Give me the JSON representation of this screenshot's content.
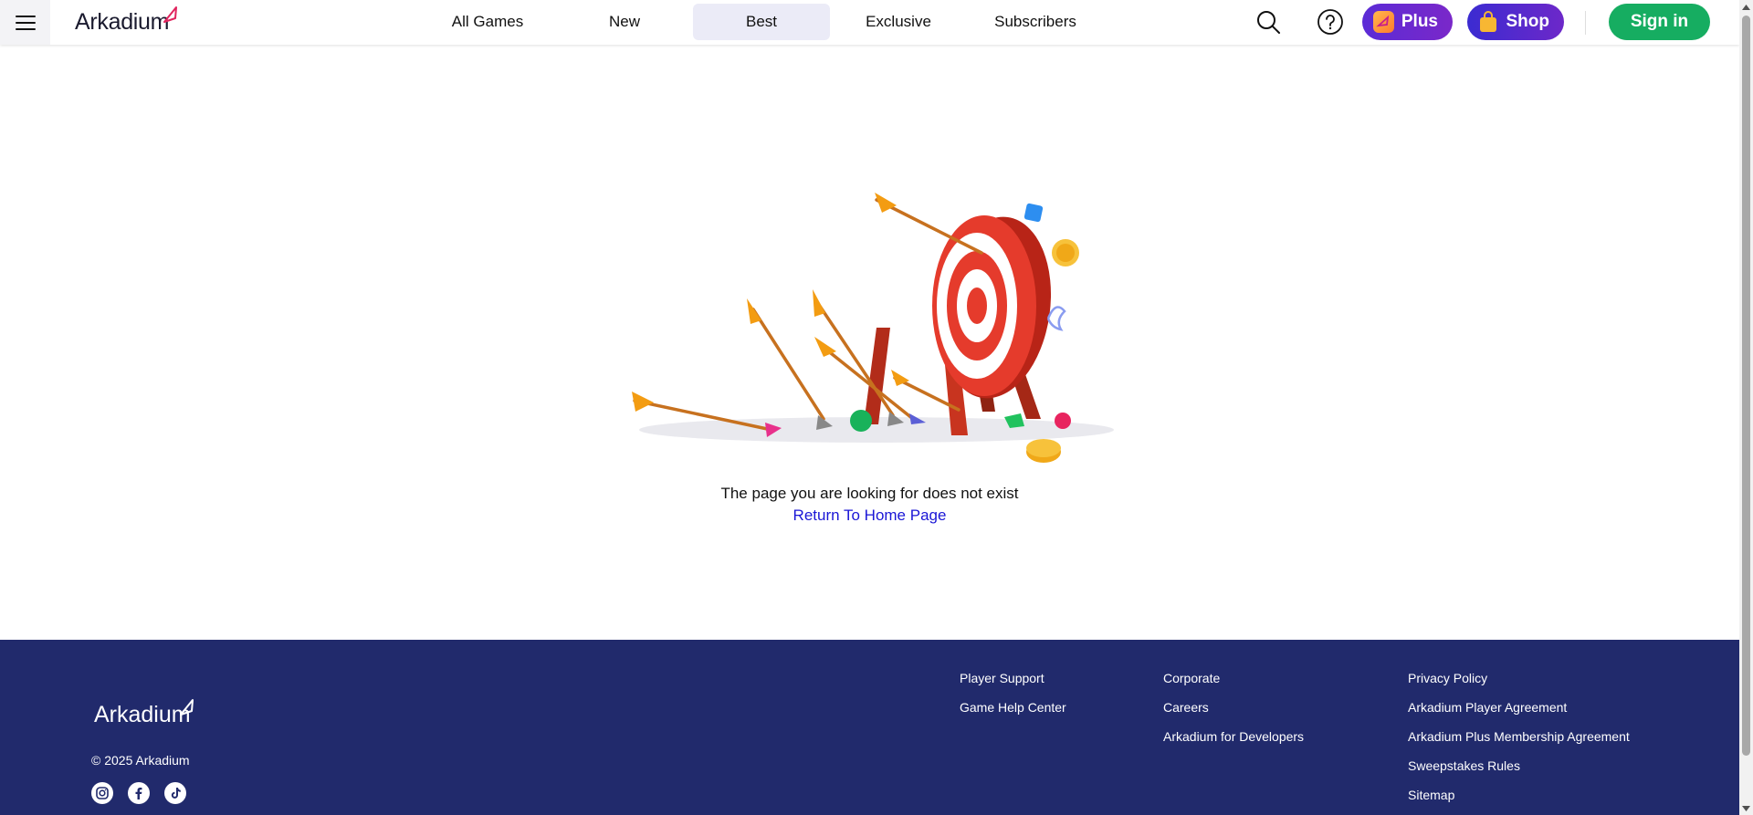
{
  "header": {
    "logo_text": "Arkadium",
    "nav": [
      {
        "label": "All Games"
      },
      {
        "label": "New"
      },
      {
        "label": "Best",
        "active": true
      },
      {
        "label": "Exclusive"
      },
      {
        "label": "Subscribers"
      }
    ],
    "plus_label": "Plus",
    "shop_label": "Shop",
    "signin_label": "Sign in",
    "icons": [
      "menu-icon",
      "search-icon",
      "help-icon",
      "plus-badge-icon",
      "shopping-bag-icon"
    ]
  },
  "main": {
    "illustration": "archery-target-with-arrows",
    "message": "The page you are looking for does not exist",
    "home_link": "Return To Home Page"
  },
  "footer": {
    "logo_text": "Arkadium",
    "copyright": "© 2025 Arkadium",
    "socials": [
      "instagram-icon",
      "facebook-icon",
      "tiktok-icon"
    ],
    "col1": [
      "Player Support",
      "Game Help Center"
    ],
    "col2": [
      "Corporate",
      "Careers",
      "Arkadium for Developers"
    ],
    "col3": [
      "Privacy Policy",
      "Arkadium Player Agreement",
      "Arkadium Plus Membership Agreement",
      "Sweepstakes Rules",
      "Sitemap"
    ]
  },
  "colors": {
    "footer_bg": "#212a6c",
    "signin_green": "#16ad61",
    "plus_purple": "#5b2bd6",
    "link_blue": "#1a16d6",
    "active_nav_bg": "#ebebf7"
  }
}
